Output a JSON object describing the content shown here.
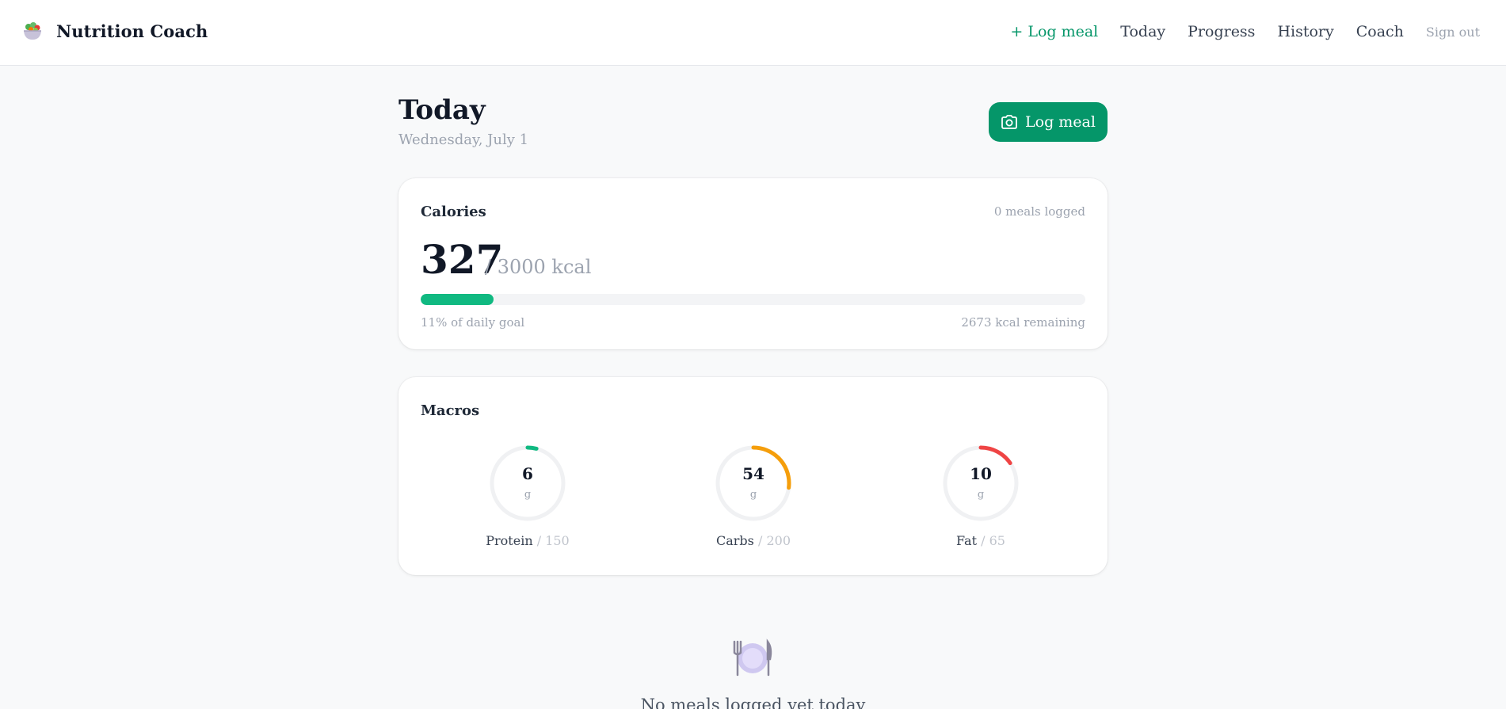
{
  "app": {
    "name": "Nutrition Coach",
    "logo_icon": "salad-bowl-icon"
  },
  "nav": {
    "log_meal": "+ Log meal",
    "today": "Today",
    "progress": "Progress",
    "history": "History",
    "coach": "Coach",
    "sign_out": "Sign out"
  },
  "page": {
    "title": "Today",
    "date": "Wednesday, July 1",
    "log_button": "Log meal",
    "log_button_icon": "camera-icon"
  },
  "calories": {
    "title": "Calories",
    "meals_logged": "0 meals logged",
    "consumed": "327",
    "goal_text": "/ 3000 kcal",
    "progress_fraction": 0.11,
    "percent_text": "11% of daily goal",
    "remaining_text": "2673 kcal remaining"
  },
  "macros": {
    "title": "Macros",
    "items": [
      {
        "name": "Protein",
        "value": "6",
        "unit": "g",
        "goal": "/ 150",
        "fraction": 0.04,
        "color": "#10b981"
      },
      {
        "name": "Carbs",
        "value": "54",
        "unit": "g",
        "goal": "/ 200",
        "fraction": 0.27,
        "color": "#f59e0b"
      },
      {
        "name": "Fat",
        "value": "10",
        "unit": "g",
        "goal": "/ 65",
        "fraction": 0.154,
        "color": "#ef4444"
      }
    ]
  },
  "empty_state": {
    "icon": "plate-cutlery-icon",
    "text": "No meals logged yet today"
  },
  "colors": {
    "accent": "#059669",
    "progress": "#10b981",
    "background": "#f8f9fa"
  }
}
